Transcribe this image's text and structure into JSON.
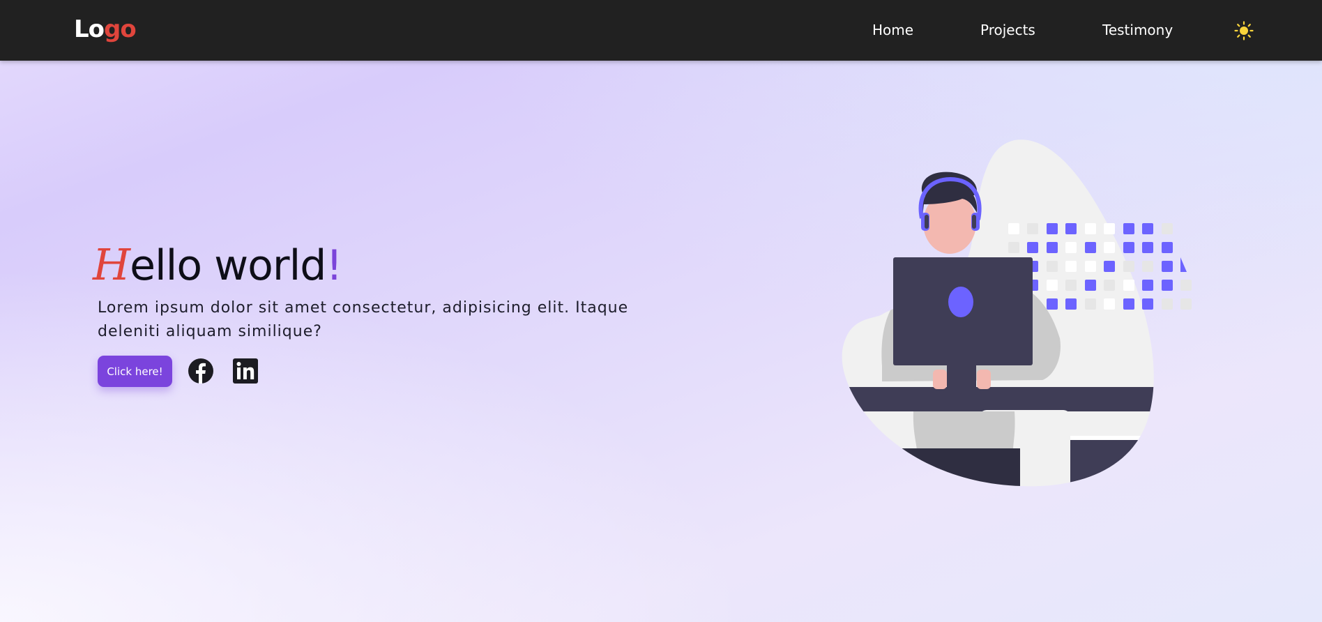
{
  "header": {
    "logo_part1": "Lo",
    "logo_part2": "go",
    "nav": [
      {
        "label": "Home"
      },
      {
        "label": "Projects"
      },
      {
        "label": "Testimony"
      }
    ],
    "theme_icon": "sun-icon"
  },
  "hero": {
    "title_first_letter": "H",
    "title_rest": "ello world",
    "title_punct": "!",
    "description": "Lorem ipsum dolor sit amet consectetur, adipisicing elit. Itaque deleniti aliquam similique?",
    "cta_label": "Click here!",
    "social_icons": [
      "facebook-icon",
      "linkedin-icon"
    ],
    "illustration": "developer-at-computer-illustration"
  },
  "colors": {
    "navbar_bg": "#212121",
    "accent_red": "#e0453c",
    "accent_purple": "#7b44dd",
    "illustration_purple": "#6c63ff",
    "sun_yellow": "#f9d43b"
  }
}
